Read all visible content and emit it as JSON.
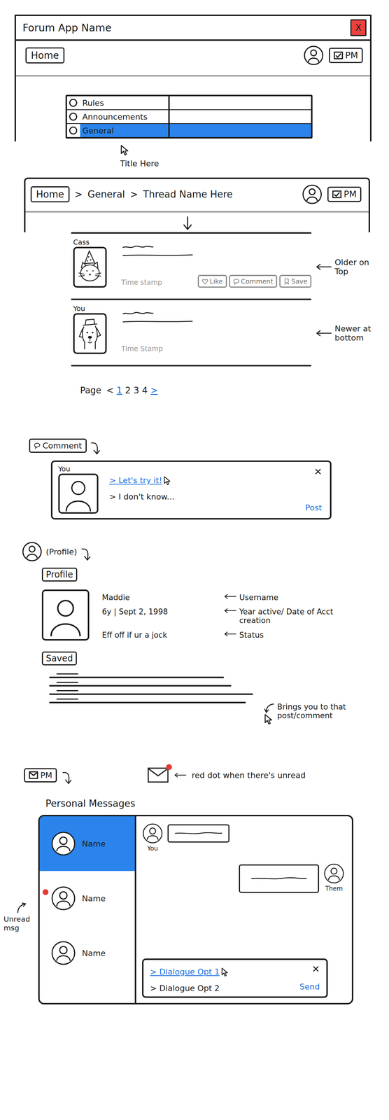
{
  "window": {
    "title": "Forum App Name",
    "close": "X"
  },
  "header": {
    "home": "Home",
    "pm": "PM"
  },
  "categories": [
    {
      "label": "Rules",
      "selected": false
    },
    {
      "label": "Announcements",
      "selected": false
    },
    {
      "label": "General",
      "selected": true
    }
  ],
  "category_note": "Title Here",
  "thread": {
    "breadcrumb": [
      "Home",
      "General",
      "Thread Name Here"
    ],
    "separator": ">",
    "pm": "PM",
    "posts": [
      {
        "author": "Cass",
        "kind": "cat",
        "timestamp": "Time stamp",
        "actions": [
          {
            "label": "Like",
            "kind": "like"
          },
          {
            "label": "Comment",
            "kind": "comment"
          },
          {
            "label": "Save",
            "kind": "save"
          }
        ],
        "note": "Older on Top"
      },
      {
        "author": "You",
        "kind": "dog",
        "timestamp": "Time Stamp",
        "actions": [],
        "note": "Newer at bottom"
      }
    ],
    "pagination": {
      "label": "Page",
      "prev": {
        "label": "<",
        "disabled": true
      },
      "next": {
        "label": ">",
        "disabled": false
      },
      "pages": [
        {
          "label": "1",
          "selected": true
        },
        {
          "label": "2",
          "selected": false
        },
        {
          "label": "3",
          "selected": false
        },
        {
          "label": "4",
          "selected": false
        }
      ]
    }
  },
  "comment_dialog": {
    "trigger": "Comment",
    "author": "You",
    "options": [
      {
        "label": "> Let's try it!",
        "selected": true
      },
      {
        "label": "> I don't know...",
        "selected": false
      }
    ],
    "close": "✕",
    "submit": "Post"
  },
  "profile": {
    "trigger": "(Profile)",
    "title": "Profile",
    "username": "Maddie",
    "joined": "6y | Sept 2, 1998",
    "status": "Eff off if ur a jock",
    "notes": [
      "Username",
      "Year active/ Date of Acct creation",
      "Status"
    ],
    "saved_title": "Saved",
    "saved_note": "Brings you to that post/comment"
  },
  "messages": {
    "trigger": "PM",
    "unread": true,
    "unread_note": "red dot when there's unread",
    "title": "Personal Messages",
    "conversations": [
      {
        "name": "Name",
        "selected": true,
        "unread": false
      },
      {
        "name": "Name",
        "selected": false,
        "unread": true
      },
      {
        "name": "Name",
        "selected": false,
        "unread": false
      }
    ],
    "conversation_note": "Unread msg",
    "thread": [
      {
        "author": "You",
        "mine": true
      },
      {
        "author": "Them",
        "mine": false
      }
    ],
    "options": [
      {
        "label": "> Dialogue Opt 1",
        "selected": true
      },
      {
        "label": "> Dialogue Opt 2",
        "selected": false
      }
    ],
    "close": "✕",
    "submit": "Send"
  }
}
